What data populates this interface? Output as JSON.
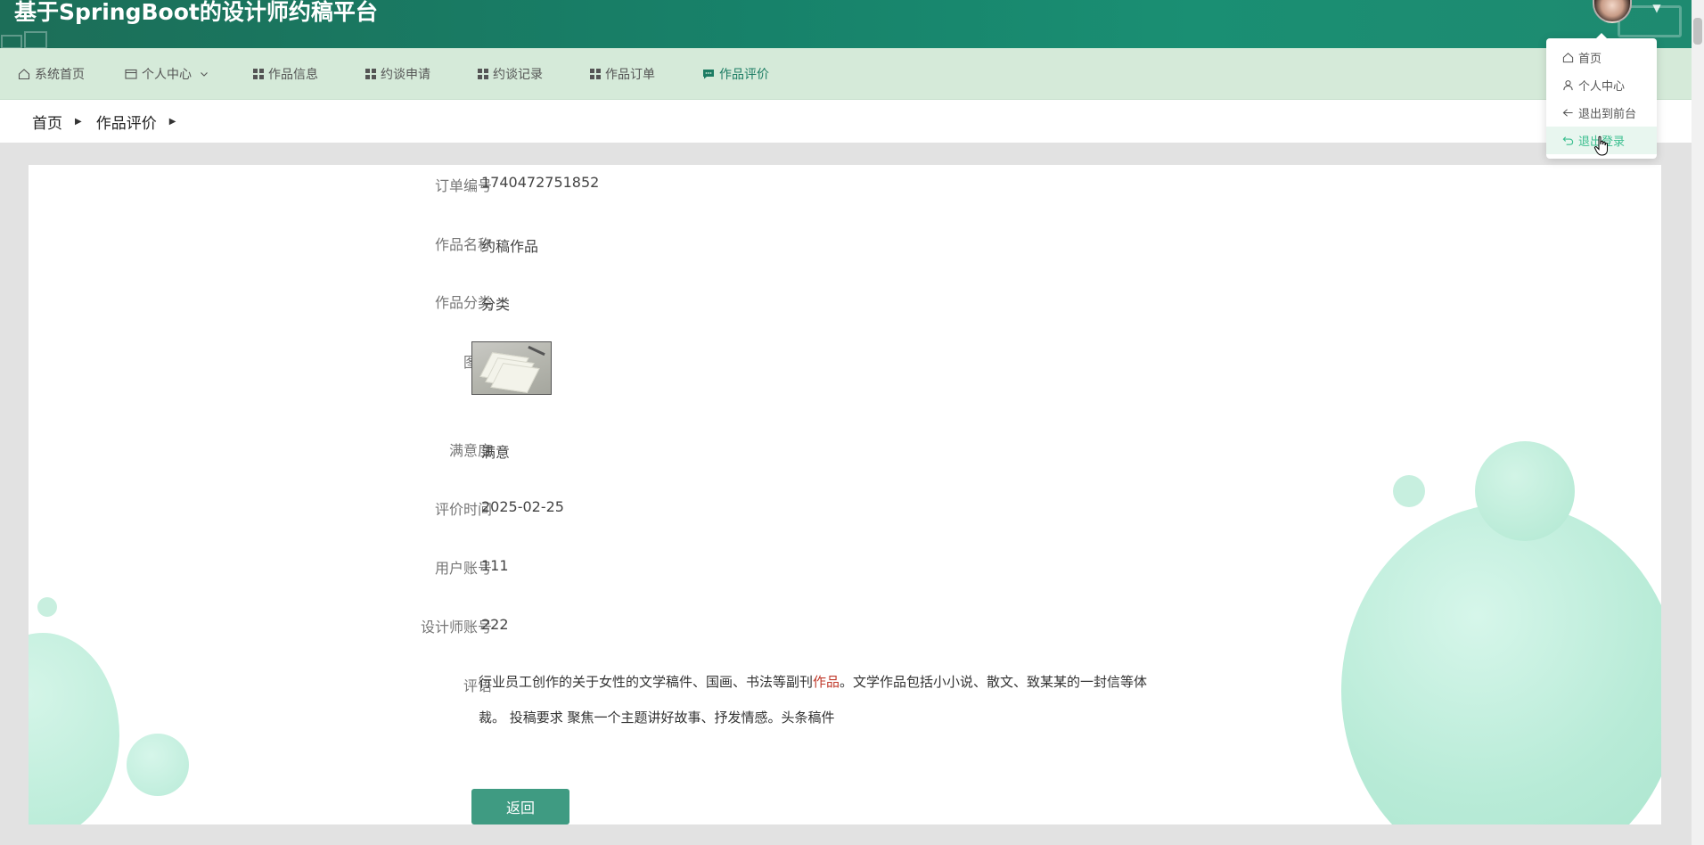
{
  "app": {
    "title": "基于SpringBoot的设计师约稿平台"
  },
  "nav": {
    "items": [
      {
        "label": "系统首页",
        "icon": "home-icon"
      },
      {
        "label": "个人中心",
        "icon": "wallet-icon",
        "has_dropdown": true
      },
      {
        "label": "作品信息",
        "icon": "grid-icon"
      },
      {
        "label": "约谈申请",
        "icon": "grid-icon"
      },
      {
        "label": "约谈记录",
        "icon": "grid-icon"
      },
      {
        "label": "作品订单",
        "icon": "grid-icon"
      },
      {
        "label": "作品评价",
        "icon": "chat-icon",
        "active": true
      }
    ],
    "active_color": "#1c7c63"
  },
  "breadcrumb": {
    "home": "首页",
    "current": "作品评价"
  },
  "detail": {
    "order_no": {
      "label": "订单编号",
      "value": "1740472751852"
    },
    "work_name": {
      "label": "作品名称",
      "value": "约稿作品"
    },
    "work_category": {
      "label": "作品分类",
      "value": "分类"
    },
    "image": {
      "label": "图片"
    },
    "satisfaction": {
      "label": "满意度",
      "value": "满意"
    },
    "review_time": {
      "label": "评价时间",
      "value": "2025-02-25"
    },
    "user_account": {
      "label": "用户账号",
      "value": "111"
    },
    "designer_account": {
      "label": "设计师账号",
      "value": "222"
    },
    "comment": {
      "label": "评语",
      "part1": "行业员工创作的关于女性的文学稿件、国画、书法等副刊",
      "highlight": "作品",
      "part2": "。文学作品包括小小说、散文、致某某的一封信等体裁。 投稿要求 聚焦一个主题讲好故事、抒发情感。头条稿件"
    }
  },
  "actions": {
    "back_label": "返回"
  },
  "user_menu": {
    "items": [
      {
        "label": "首页",
        "icon": "home-icon"
      },
      {
        "label": "个人中心",
        "icon": "user-icon"
      },
      {
        "label": "退出到前台",
        "icon": "back-arrow-icon"
      },
      {
        "label": "退出登录",
        "icon": "logout-icon",
        "hovered": true
      }
    ]
  },
  "colors": {
    "header": "#17826a",
    "nav_bg": "#d5ead9",
    "button": "#3f9b82",
    "bubble": "#bdeedb"
  }
}
